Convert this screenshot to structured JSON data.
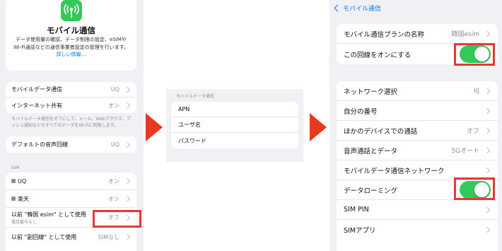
{
  "left": {
    "app_icon": "antenna-icon",
    "title": "モバイル通信",
    "description": "データ使用量の確認、データ制限の設定、eSIMや Wi-Fi通話などの通信事業者設定の管理を行います。",
    "learn_more": "詳しい情報...",
    "rows_a": [
      {
        "label": "モバイルデータ通信",
        "value": "UQ"
      },
      {
        "label": "インターネット共有",
        "value": "オン"
      }
    ],
    "note": "モバイルデータ通信をオフにして、メール、Webブラウズ、プッシュ通知などのすべてのデータをWi-Fiに制限します。",
    "rows_b": [
      {
        "label": "デフォルトの音声回線",
        "value": "UQ"
      }
    ],
    "sim_header": "SIM",
    "sim_rows": [
      {
        "label": "UQ",
        "value": "オン"
      },
      {
        "label": "楽天",
        "value": "オン"
      },
      {
        "label": "以前 \"韓国 esim\" として使用",
        "sub": "電話番号なし",
        "value": "オフ"
      },
      {
        "label": "以前 \"副回線\" として使用",
        "value": "SIMなし"
      }
    ]
  },
  "middle": {
    "header": "モバイルデータ通信",
    "rows": [
      "APN",
      "ユーザ名",
      "パスワード"
    ]
  },
  "right": {
    "back_label": "モバイル通信",
    "rows_a": [
      {
        "label": "モバイル通信プランの名称",
        "value": "韓国esim",
        "type": "chevron"
      },
      {
        "label": "この回線をオンにする",
        "type": "toggle",
        "on": true
      }
    ],
    "rows_b": [
      {
        "label": "ネットワーク選択",
        "value": "IIJ",
        "type": "chevron"
      },
      {
        "label": "自分の番号",
        "value": "",
        "type": "chevron"
      },
      {
        "label": "ほかのデバイスでの通話",
        "value": "オフ",
        "type": "chevron"
      },
      {
        "label": "音声通話とデータ",
        "value": "5Gオート",
        "type": "chevron"
      },
      {
        "label": "モバイルデータ通信ネットワーク",
        "value": "",
        "type": "chevron"
      },
      {
        "label": "データローミング",
        "type": "toggle",
        "on": true
      },
      {
        "label": "SIM PIN",
        "value": "",
        "type": "chevron"
      },
      {
        "label": "SIMアプリ",
        "value": "",
        "type": "chevron"
      }
    ]
  },
  "colors": {
    "accent": "#007aff",
    "toggle_on": "#34c759",
    "highlight": "#e53935",
    "arrow": "#e8381f",
    "background": "#f0f0f5",
    "secondary_text": "#8e8e93"
  }
}
